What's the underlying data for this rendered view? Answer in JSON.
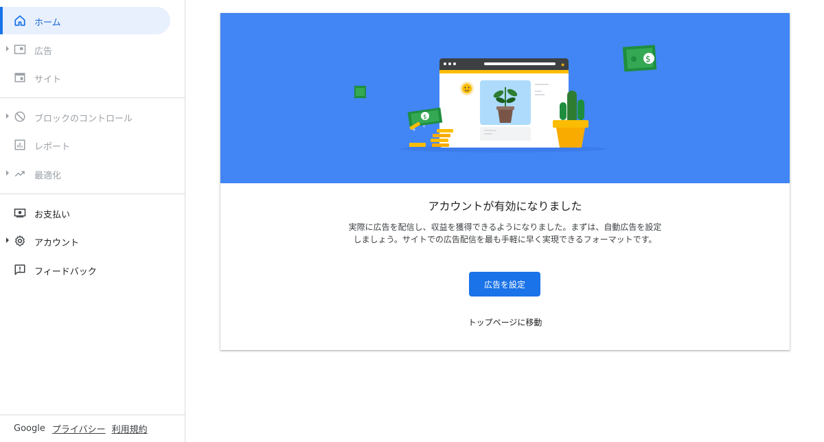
{
  "sidebar": {
    "items": [
      {
        "label": "ホーム",
        "icon": "home-icon"
      },
      {
        "label": "広告",
        "icon": "ads-icon"
      },
      {
        "label": "サイト",
        "icon": "sites-icon"
      },
      {
        "label": "ブロックのコントロール",
        "icon": "block-icon"
      },
      {
        "label": "レポート",
        "icon": "reports-icon"
      },
      {
        "label": "最適化",
        "icon": "optimization-icon"
      },
      {
        "label": "お支払い",
        "icon": "payments-icon"
      },
      {
        "label": "アカウント",
        "icon": "gear-icon"
      },
      {
        "label": "フィードバック",
        "icon": "feedback-icon"
      }
    ]
  },
  "footer": {
    "brand": "Google",
    "privacy": "プライバシー",
    "terms": "利用規約"
  },
  "main": {
    "title": "アカウントが有効になりました",
    "description": "実際に広告を配信し、収益を獲得できるようになりました。まずは、自動広告を設定しましょう。サイトでの広告配信を最も手軽に早く実現できるフォーマットです。",
    "primary_button": "広告を設定",
    "secondary_link": "トップページに移動"
  },
  "colors": {
    "accent": "#1a73e8",
    "hero_bg": "#4285f4",
    "active_bg": "#e8f0fe",
    "money_green": "#34a853",
    "gold": "#fbbc04"
  }
}
